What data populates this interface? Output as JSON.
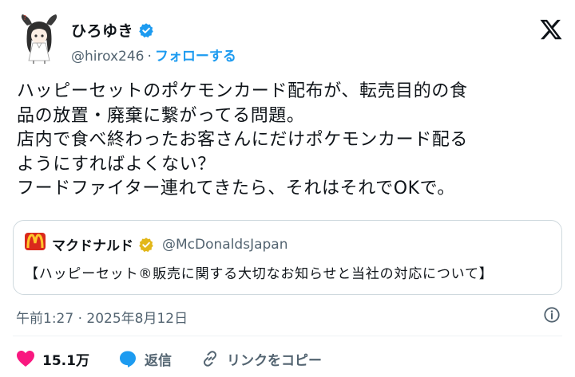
{
  "author": {
    "display_name": "ひろゆき",
    "handle": "@hirox246",
    "separator": "·",
    "follow_label": "フォローする"
  },
  "tweet": {
    "text": "ハッピーセットのポケモンカード配布が、転売目的の食\n品の放置・廃棄に繋がってる問題。\n店内で食べ終わったお客さんにだけポケモンカード配る\nようにすればよくない？\nフードファイター連れてきたら、それはそれでOKで。"
  },
  "quote": {
    "name": "マクドナルド",
    "handle": "@McDonaldsJapan",
    "text": "【ハッピーセット®販売に関する大切なお知らせと当社の対応について】"
  },
  "meta": {
    "timestamp": "午前1:27 · 2025年8月12日"
  },
  "actions": {
    "like_count": "15.1万",
    "reply_label": "返信",
    "copy_link_label": "リンクをコピー"
  },
  "colors": {
    "accent": "#1d9bf0",
    "like": "#f91880",
    "mcd_red": "#da291c",
    "mcd_yellow": "#ffc72c",
    "gold_badge": "#e2b719"
  },
  "icons": [
    "avatar",
    "verified-badge-icon",
    "x-logo-icon",
    "mcdonalds-logo",
    "gold-verified-badge-icon",
    "info-icon",
    "heart-icon",
    "reply-icon",
    "link-icon"
  ]
}
